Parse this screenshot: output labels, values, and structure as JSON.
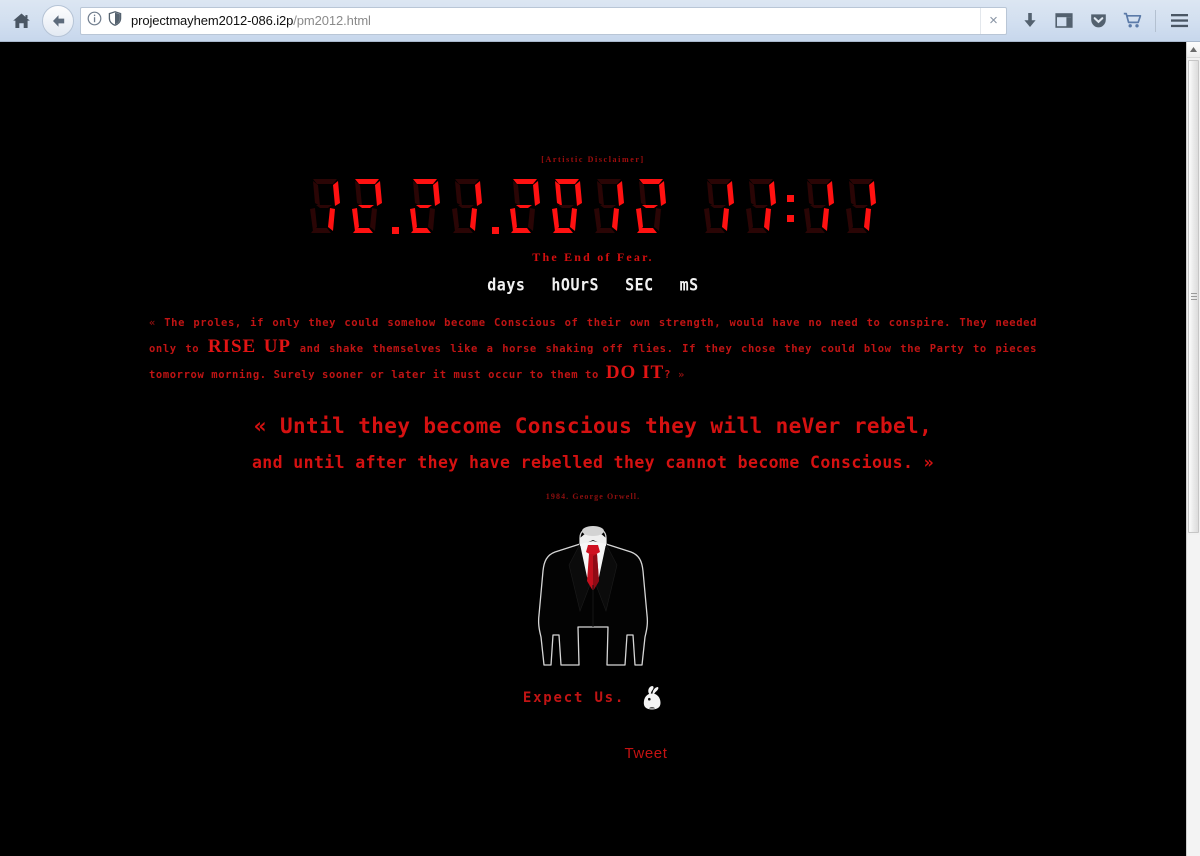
{
  "browser": {
    "home_button": "home-icon",
    "back_button": "back-arrow-icon",
    "identity_icon": "info-circle-icon",
    "shield_icon": "shield-icon",
    "url_host": "projectmayhem2012-086.i2p",
    "url_path": "/pm2012.html",
    "url_full": "projectmayhem2012-086.i2p/pm2012.html",
    "clear_button": "×",
    "toolbar_icons": [
      {
        "name": "downloads-icon",
        "glyph": "↓"
      },
      {
        "name": "sidebar-icon",
        "glyph": "◱"
      },
      {
        "name": "pocket-icon",
        "glyph": "↓"
      },
      {
        "name": "cart-icon",
        "glyph": "⛉"
      },
      {
        "name": "menu-hamburger-icon",
        "glyph": "☰"
      }
    ]
  },
  "page": {
    "background_color": "#000000",
    "accent_color": "#cc0000",
    "disclaimer": "[Artistic Disclaimer]",
    "clock": {
      "date_digits": [
        "1",
        "2",
        ".",
        "2",
        "1",
        ".",
        "2",
        "0",
        "1",
        "2"
      ],
      "date_text": "12.21.2012",
      "time_text": "11:11",
      "time_digits": [
        "1",
        "1",
        ":",
        "1",
        "1"
      ],
      "lit_color": "#ff1111",
      "unlit_color": "#2a0505"
    },
    "tagline": "The End of Fear.",
    "counter_labels": [
      "days",
      "hOUrS",
      "SEC",
      "mS"
    ],
    "proles_paragraph": {
      "open_guillemet": "«",
      "part1": " The proles, if only they could somehow become Conscious of their own strength, would have no need to conspire. They needed only to ",
      "emphasis1": "RISE UP",
      "part2": " and shake themselves like a horse shaking off flies. If they chose they could blow the Party to pieces tomorrow morning. Surely sooner or later it must occur to them to ",
      "emphasis2": "DO IT",
      "part3": "? ",
      "close_guillemet": "»"
    },
    "quote_line_1": "« Until they become Conscious they will neVer rebel,",
    "quote_line_2": "and until after they have rebelled they cannot become Conscious. »",
    "attribution": "1984. George Orwell.",
    "figure_alt": "anonymous-suit-figure",
    "expect_us": "Expect Us.",
    "rabbit_alt": "white-rabbit-icon",
    "tweet_label": "Tweet"
  },
  "scrollbar": {
    "up_arrow": "▲",
    "position_percent": 0
  }
}
